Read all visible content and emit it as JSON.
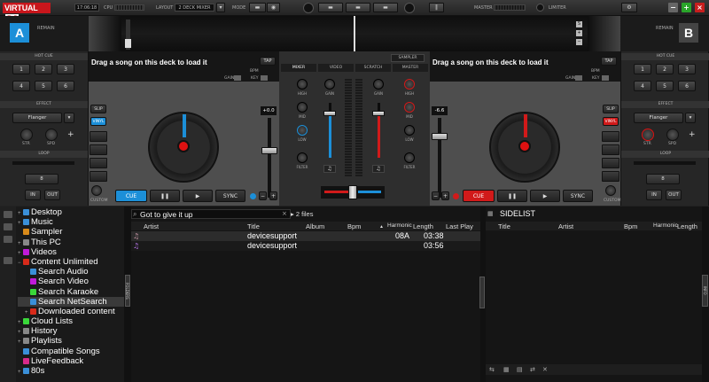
{
  "app": {
    "logo_main": "VIRTUAL",
    "logo_dj": "DJ",
    "time": "17:06:18",
    "cpu_label": "CPU",
    "layout_label": "LAYOUT",
    "layout_value": "2 DECK MIXER",
    "mode_label": "MODE",
    "master_label": "MASTER",
    "limiter_label": "LIMITER",
    "brand_red": "#c8161c",
    "accent_blue": "#1c8fd8"
  },
  "decks": {
    "left": {
      "letter": "A",
      "remain": "REMAIN",
      "load_text": "Drag a song on this deck to load it",
      "bpm": "BPM",
      "gain": "GAIN",
      "key": "KEY",
      "tap": "TAP",
      "pitch": "+0.0",
      "slip": "SLIP",
      "vinyl": "VINYL",
      "custom": "CUSTOM",
      "cue": "CUE",
      "pause": "❚❚",
      "play": "▶",
      "sync": "SYNC",
      "color": "#1c8fd8"
    },
    "right": {
      "letter": "B",
      "remain": "REMAIN",
      "load_text": "Drag a song on this deck to load it",
      "bpm": "BPM",
      "gain": "GAIN",
      "key": "KEY",
      "tap": "TAP",
      "pitch": "-6.6",
      "slip": "SLIP",
      "vinyl": "VINYL",
      "custom": "CUSTOM",
      "cue": "CUE",
      "pause": "❚❚",
      "play": "▶",
      "sync": "SYNC",
      "color": "#d11a1a"
    }
  },
  "side": {
    "hot_cue": "HOT CUE",
    "cues": [
      "1",
      "2",
      "3",
      "4",
      "5",
      "6"
    ],
    "effect": "EFFECT",
    "effect_value": "Flanger",
    "knob1": "STR",
    "knob2": "SPD",
    "loop": "LOOP",
    "loop_value": "8",
    "in": "IN",
    "out": "OUT"
  },
  "mixer": {
    "sampler": "SAMPLER",
    "tabs": [
      "MIXER",
      "VIDEO",
      "SCRATCH",
      "MASTER"
    ],
    "gain": "GAIN",
    "high": "HIGH",
    "mid": "MID",
    "low": "LOW",
    "filter": "FILTER"
  },
  "browser": {
    "folders": [
      {
        "label": "Desktop",
        "color": "#3a8fd8",
        "plus": "+",
        "indent": 0
      },
      {
        "label": "Music",
        "color": "#3a8fd8",
        "plus": "+",
        "indent": 0
      },
      {
        "label": "Sampler",
        "color": "#d88a1a",
        "plus": "",
        "indent": 0
      },
      {
        "label": "This PC",
        "color": "#888888",
        "plus": "+",
        "indent": 0
      },
      {
        "label": "Videos",
        "color": "#c01ad8",
        "plus": "+",
        "indent": 0
      },
      {
        "label": "Content Unlimited",
        "color": "#d82a1a",
        "plus": "−",
        "indent": 0
      },
      {
        "label": "Search Audio",
        "color": "#3a8fd8",
        "plus": "",
        "indent": 1
      },
      {
        "label": "Search Video",
        "color": "#c01ad8",
        "plus": "",
        "indent": 1
      },
      {
        "label": "Search Karaoke",
        "color": "#3ad83a",
        "plus": "",
        "indent": 1
      },
      {
        "label": "Search NetSearch",
        "color": "#3a8fd8",
        "plus": "",
        "indent": 1,
        "selected": true
      },
      {
        "label": "Downloaded content",
        "color": "#d82a1a",
        "plus": "+",
        "indent": 1
      },
      {
        "label": "Cloud Lists",
        "color": "#3ad83a",
        "plus": "+",
        "indent": 0
      },
      {
        "label": "History",
        "color": "#888888",
        "plus": "+",
        "indent": 0
      },
      {
        "label": "Playlists",
        "color": "#888888",
        "plus": "+",
        "indent": 0
      },
      {
        "label": "Compatible Songs",
        "color": "#3a8fd8",
        "plus": "",
        "indent": 0
      },
      {
        "label": "LiveFeedback",
        "color": "#d82a8a",
        "plus": "",
        "indent": 0
      },
      {
        "label": "80s",
        "color": "#3a8fd8",
        "plus": "+",
        "indent": 0
      }
    ],
    "search_value": "Got to give it up",
    "file_count": "2 files",
    "columns": [
      "Artist",
      "Title",
      "Album",
      "Bpm",
      "Harmonic",
      "Length",
      "Last Play"
    ],
    "rows": [
      {
        "artist": "",
        "title": "devicesupport",
        "album": "",
        "bpm": "",
        "harmonic": "08A",
        "length": "03:38",
        "last_play": ""
      },
      {
        "artist": "",
        "title": "devicesupport",
        "album": "",
        "bpm": "",
        "harmonic": "",
        "length": "03:56",
        "last_play": ""
      }
    ],
    "sidelist_title": "SIDELIST",
    "sidelist_columns": [
      "Title",
      "Artist",
      "Bpm",
      "Harmonic",
      "Length"
    ],
    "folders_grip": "FOLDERS",
    "info_grip": "INFO"
  }
}
